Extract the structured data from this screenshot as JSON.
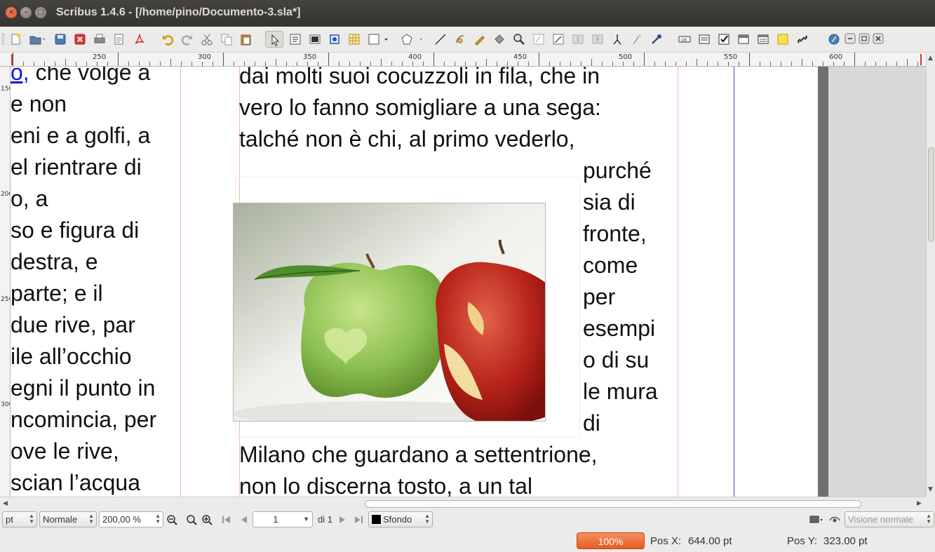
{
  "window": {
    "title": "Scribus 1.4.6 - [/home/pino/Documento-3.sla*]",
    "close_glyph": "×",
    "minimize_glyph": "–",
    "maximize_glyph": "□"
  },
  "toolbar": {
    "icons": [
      "new-document-icon",
      "open-icon",
      "save-icon",
      "close-document-icon",
      "print-icon",
      "preflight-icon",
      "export-pdf-icon",
      "undo-icon",
      "redo-icon",
      "cut-icon",
      "copy-icon",
      "paste-icon",
      "select-icon",
      "text-frame-icon",
      "image-frame-icon",
      "render-frame-icon",
      "table-icon",
      "shape-icon",
      "polygon-icon",
      "line-icon",
      "bezier-icon",
      "freehand-icon",
      "rotate-icon",
      "zoom-icon",
      "edit-contents-icon",
      "edit-text-icon",
      "link-frames-icon",
      "unlink-frames-icon",
      "measure-icon",
      "copy-properties-icon",
      "eyedropper-icon",
      "pdf-button-icon",
      "pdf-text-field-icon",
      "pdf-checkbox-icon",
      "pdf-combobox-icon",
      "pdf-listbox-icon",
      "pdf-annotation-icon",
      "pdf-link-icon",
      "help-icon",
      "minimize-doc-icon",
      "restore-doc-icon",
      "close-doc-icon"
    ]
  },
  "ruler": {
    "labels": [
      "250",
      "300",
      "350",
      "400",
      "450",
      "500",
      "550",
      "600"
    ],
    "vertical_labels": [
      "150",
      "200",
      "250",
      "300"
    ]
  },
  "document": {
    "left_column": [
      {
        "link": "o,",
        "text": " che volge a"
      },
      {
        "link": "",
        "text": "e non"
      },
      {
        "link": "",
        "text": "eni e a golfi, a"
      },
      {
        "link": "",
        "text": "el rientrare di"
      },
      {
        "link": "",
        "text": "o, a"
      },
      {
        "link": "",
        "text": "so e figura di"
      },
      {
        "link": "",
        "text": " destra, e"
      },
      {
        "link": "",
        "text": " parte; e il"
      },
      {
        "link": "",
        "text": "due rive, par"
      },
      {
        "link": "",
        "text": "ile all’occhio"
      },
      {
        "link": "",
        "text": "egni il punto in"
      },
      {
        "link": "",
        "text": "ncomincia, per"
      },
      {
        "link": "",
        "text": "ove le rive,"
      },
      {
        "link": "",
        "text": "scian l’acqua"
      }
    ],
    "right_column_top": [
      "dai molti suoi cocuzzoli in fila, che in",
      "vero lo fanno somigliare a una sega:",
      "talché non è chi, al primo vederlo,"
    ],
    "right_wrap": [
      "purché",
      "sia di",
      "fronte,",
      "come",
      "per",
      "esempi",
      "o di su",
      "le mura",
      "di"
    ],
    "right_column_bottom": [
      "Milano che guardano a settentrione,",
      "non lo discerna tosto, a un tal"
    ],
    "image_alt": "green and red apples"
  },
  "bottombar": {
    "unit": "pt",
    "style": "Normale",
    "zoom": "200,00 %",
    "page_number": "1",
    "of_pages": "di 1",
    "layer": "Sfondo",
    "view_mode": "Visione normale"
  },
  "statusbar": {
    "zoom_progress": "100%",
    "pos_x_label": "Pos X:",
    "pos_x_value": "644.00 pt",
    "pos_y_label": "Pos Y:",
    "pos_y_value": "323.00 pt"
  },
  "colors": {
    "title_bg": "#3c3b37",
    "accent_orange": "#e65b23",
    "link_blue": "#1515d8",
    "margin_guide": "#f2b9b9",
    "column_guide": "#4a3fd6"
  }
}
